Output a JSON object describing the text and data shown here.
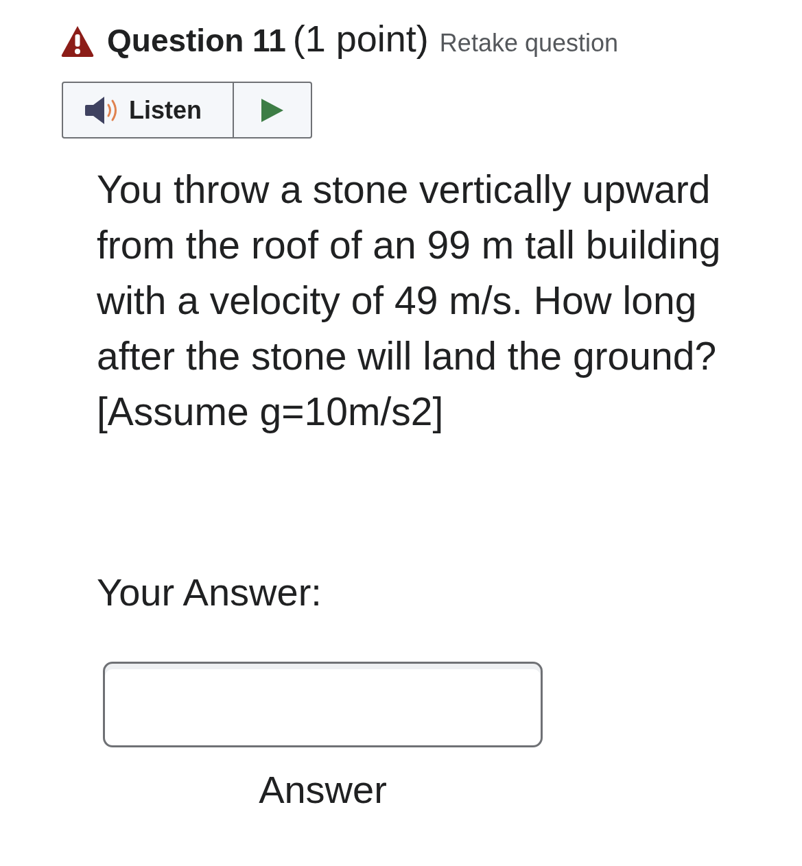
{
  "question": {
    "title": "Question 11",
    "points": "(1 point)",
    "retake": "Retake question"
  },
  "listen": {
    "label": "Listen"
  },
  "prompt": {
    "text": "You throw a stone vertically upward from the roof of an 99 m tall building with a velocity of 49 m/s. How long after the stone will land the ground? [Assume g=10m/s2]"
  },
  "answer": {
    "heading": "Your Answer:",
    "field_label": "Answer"
  }
}
